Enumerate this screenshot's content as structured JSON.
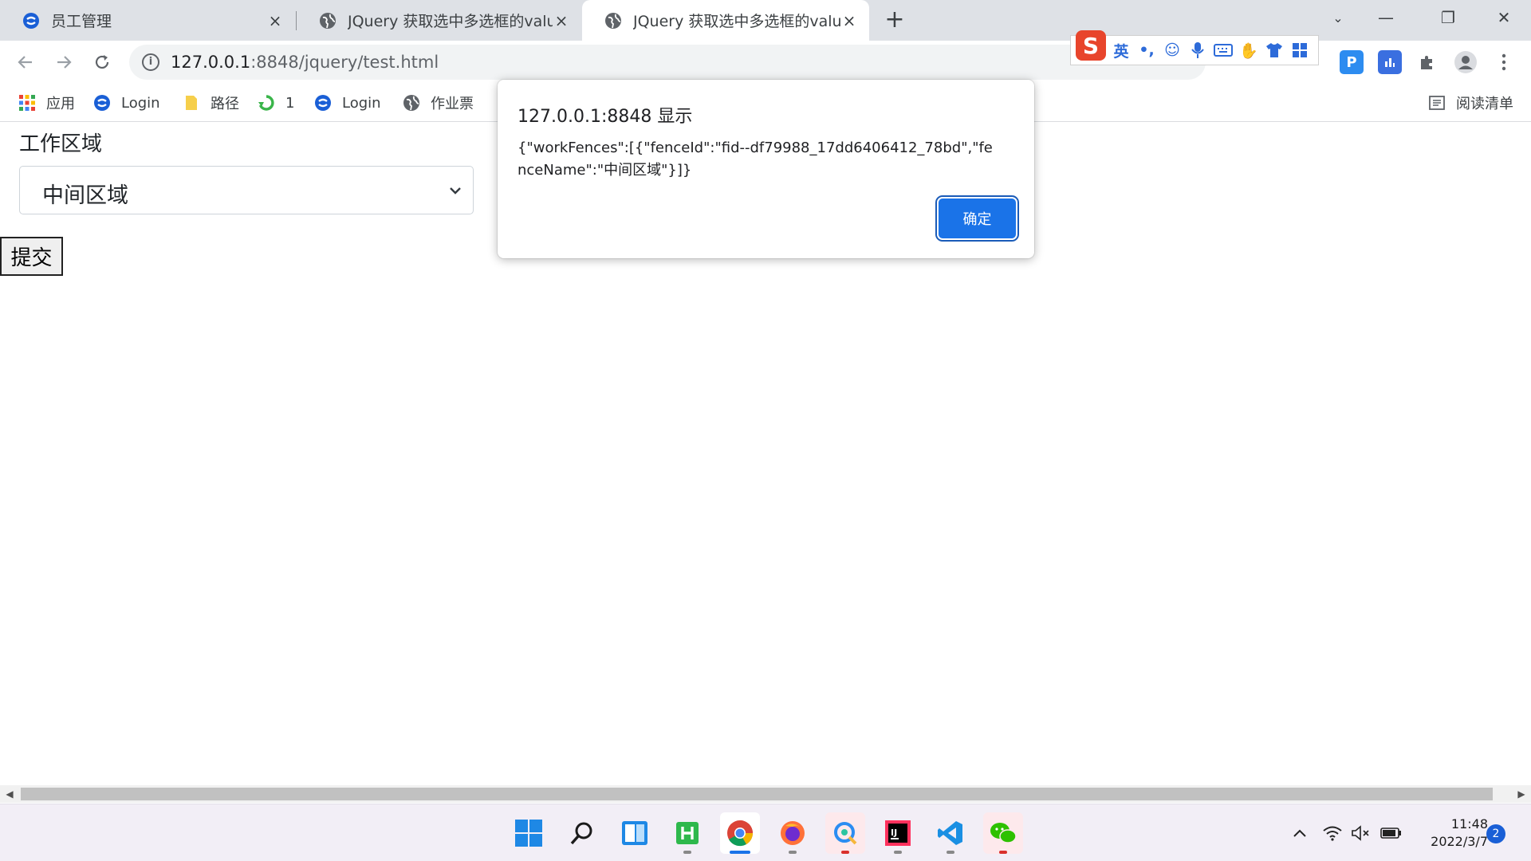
{
  "browser": {
    "tabs": [
      {
        "title": "员工管理",
        "close": "×"
      },
      {
        "title": "JQuery 获取选中多选框的value, ",
        "close": "×"
      },
      {
        "title": "JQuery 获取选中多选框的value, ",
        "close": "×"
      }
    ],
    "new_tab": "+",
    "window_controls": {
      "minimize": "—",
      "restore": "❐",
      "close": "✕"
    },
    "address": {
      "host": "127.0.0.1",
      "port_path": ":8848/jquery/test.html",
      "info_icon": "i"
    },
    "bookmarks": [
      {
        "label": "应用",
        "icon": "apps-grid-icon"
      },
      {
        "label": "Login",
        "icon": "login-logo-icon"
      },
      {
        "label": "路径",
        "icon": "folder-icon"
      },
      {
        "label": "1",
        "icon": "green-cycle-icon"
      },
      {
        "label": "Login",
        "icon": "login-logo-icon"
      },
      {
        "label": "作业票",
        "icon": "globe-icon"
      }
    ],
    "reading_list": "阅读清单",
    "ime": {
      "logo": "S",
      "lang": "英",
      "punct": "•,"
    },
    "extension_p": "P"
  },
  "page": {
    "field_label": "工作区域",
    "select_value": "中间区域",
    "submit_label": "提交"
  },
  "dialog": {
    "title": "127.0.0.1:8848 显示",
    "message": "{\"workFences\":[{\"fenceId\":\"fid--df79988_17dd6406412_78bd\",\"fenceName\":\"中间区域\"}]}",
    "ok_label": "确定"
  },
  "taskbar": {
    "time": "11:48",
    "date": "2022/3/7",
    "notifications": "2",
    "apps": [
      "start",
      "search",
      "widgets",
      "hbuilder",
      "chrome",
      "firefox",
      "qq-browser",
      "intellij",
      "vscode",
      "wechat"
    ]
  },
  "colors": {
    "accent": "#1a73e8",
    "tabstrip": "#dee1e6",
    "taskbar": "#f2eef6"
  }
}
